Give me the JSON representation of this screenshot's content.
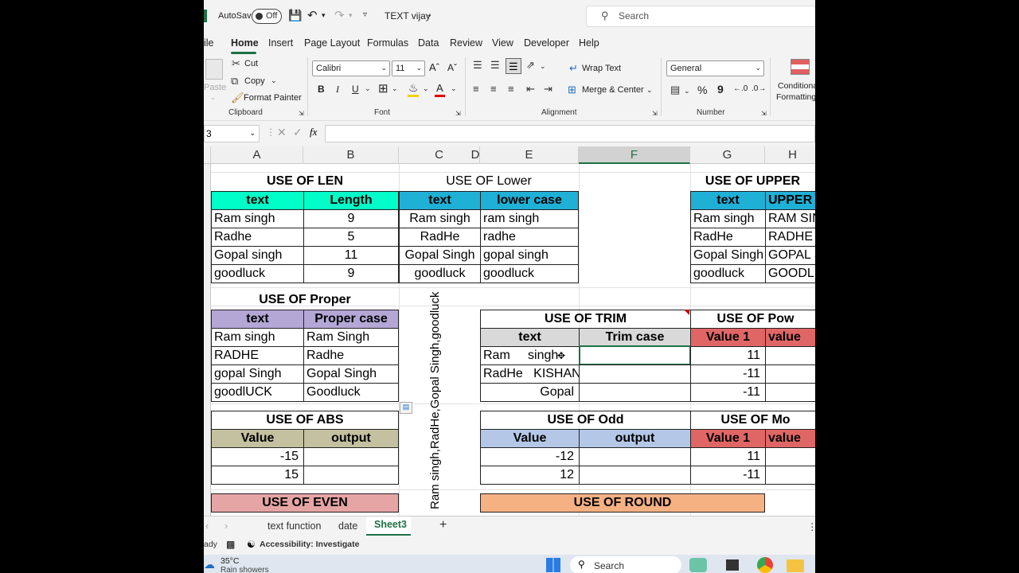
{
  "titlebar": {
    "autosave": "AutoSave",
    "toggle": "Off",
    "filename": "TEXT vijay",
    "search_placeholder": "Search"
  },
  "tabs": [
    "ile",
    "Home",
    "Insert",
    "Page Layout",
    "Formulas",
    "Data",
    "Review",
    "View",
    "Developer",
    "Help"
  ],
  "ribbon": {
    "clipboard": {
      "paste": "Paste",
      "cut": "Cut",
      "copy": "Copy",
      "format_painter": "Format Painter",
      "group": "Clipboard"
    },
    "font": {
      "name": "Calibri",
      "size": "11",
      "bold": "B",
      "italic": "I",
      "underline": "U",
      "group": "Font"
    },
    "alignment": {
      "wrap": "Wrap Text",
      "merge": "Merge & Center",
      "group": "Alignment"
    },
    "number": {
      "format": "General",
      "percent": "%",
      "comma": "9",
      "group": "Number"
    },
    "styles": {
      "cond1": "Conditional",
      "cond2": "Formatting"
    }
  },
  "formula_bar": {
    "namebox": "3",
    "fx": "fx",
    "value": ""
  },
  "columns": [
    "A",
    "B",
    "C",
    "D",
    "E",
    "F",
    "G",
    "H"
  ],
  "sheet": {
    "len": {
      "title": "USE OF LEN",
      "h1": "text",
      "h2": "Length",
      "rows": [
        [
          "Ram singh",
          "9"
        ],
        [
          "Radhe",
          "5"
        ],
        [
          "Gopal singh",
          "11"
        ],
        [
          "goodluck",
          "9"
        ]
      ]
    },
    "lower": {
      "title": "USE OF Lower",
      "h1": "text",
      "h2": "lower case",
      "rows": [
        [
          "Ram singh",
          "ram singh"
        ],
        [
          "RadHe",
          "radhe"
        ],
        [
          "Gopal Singh",
          "gopal singh"
        ],
        [
          "goodluck",
          "goodluck"
        ]
      ]
    },
    "upper": {
      "title": "USE OF UPPER",
      "h1": "text",
      "h2": "UPPER c",
      "rows": [
        [
          "Ram singh",
          "RAM SIN"
        ],
        [
          "RadHe",
          "RADHE"
        ],
        [
          "Gopal Singh",
          "GOPAL S"
        ],
        [
          "goodluck",
          "GOODLU"
        ]
      ]
    },
    "proper": {
      "title": "USE OF Proper",
      "h1": "text",
      "h2": "Proper case",
      "rows": [
        [
          "Ram singh",
          "Ram Singh"
        ],
        [
          "RADHE",
          "Radhe"
        ],
        [
          "gopal Singh",
          "Gopal Singh"
        ],
        [
          "goodlUCK",
          "Goodluck"
        ]
      ]
    },
    "trim": {
      "title": "USE OF TRIM",
      "h1": "text",
      "h2": "Trim case",
      "rows": [
        "Ram     singh",
        "RadHe   KISHAN",
        "Gopal"
      ]
    },
    "power": {
      "title": "USE OF Pow",
      "h1": "Value 1",
      "h2": "value",
      "rows": [
        "11",
        "-11",
        "-11"
      ]
    },
    "abs": {
      "title": "USE OF ABS",
      "h1": "Value",
      "h2": "output",
      "rows": [
        "-15",
        "15"
      ]
    },
    "odd": {
      "title": "USE OF Odd",
      "h1": "Value",
      "h2": "output",
      "rows": [
        "-12",
        "12"
      ]
    },
    "mod": {
      "title": "USE OF Mo",
      "h1": "Value 1",
      "h2": "value",
      "rows": [
        "11",
        "-11"
      ]
    },
    "even": {
      "title": "USE OF EVEN"
    },
    "round": {
      "title": "USE OF ROUND"
    },
    "vertical_text": "Ram singh,RadHe,Gopal Singh,goodluck"
  },
  "sheet_tabs": [
    "text function",
    "date",
    "Sheet3"
  ],
  "status": {
    "ready": "ady",
    "accessibility": "Accessibility: Investigate"
  },
  "taskbar": {
    "temp": "35°C",
    "weather": "Rain showers",
    "search": "Search"
  }
}
